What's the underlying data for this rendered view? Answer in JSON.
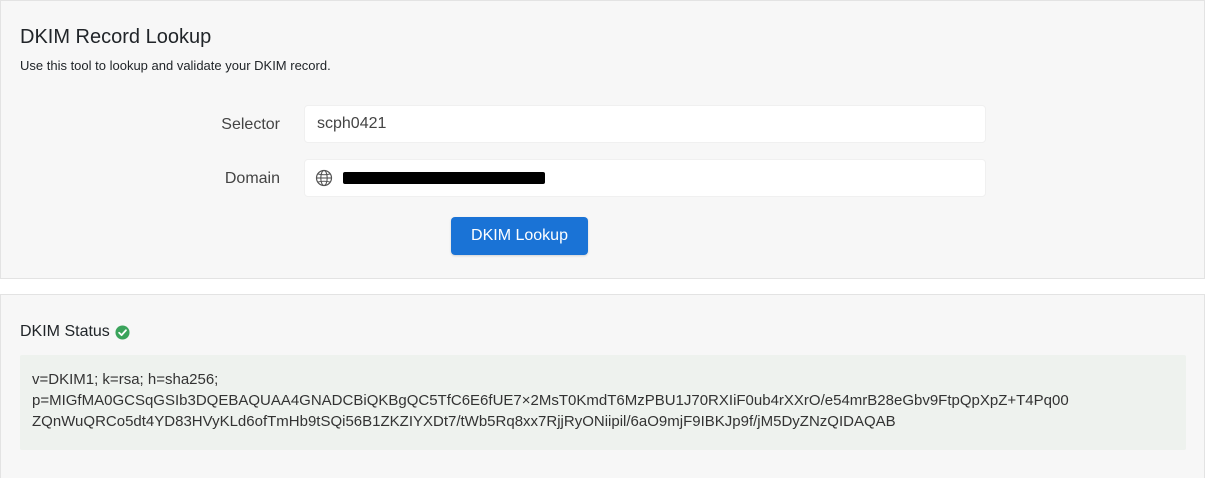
{
  "header": {
    "title": "DKIM Record Lookup",
    "subtitle": "Use this tool to lookup and validate your DKIM record."
  },
  "form": {
    "selector_label": "Selector",
    "selector_value": "scph0421",
    "domain_label": "Domain",
    "domain_value": "",
    "domain_redacted": true,
    "button_label": "DKIM Lookup"
  },
  "status": {
    "label": "DKIM Status",
    "valid": true,
    "icon": "check-circle-icon",
    "record_lines": [
      "v=DKIM1; k=rsa; h=sha256;",
      "p=MIGfMA0GCSqGSIb3DQEBAQUAA4GNADCBiQKBgQC5TfC6E6fUE7×2MsT0KmdT6MzPBU1J70RXIiF0ub4rXXrO/e54mrB28eGbv9FtpQpXpZ+T4Pq00",
      "ZQnWuQRCo5dt4YD83HVyKLd6ofTmHb9tSQi56B1ZKZIYXDt7/tWb5Rq8xx7RjjRyONiipil/6aO9mjF9IBKJp9f/jM5DyZNzQIDAQAB"
    ]
  },
  "colors": {
    "button": "#1a73d6",
    "success": "#3aa35b",
    "panel_bg": "#f7f7f7",
    "record_bg": "#eef2ee"
  }
}
